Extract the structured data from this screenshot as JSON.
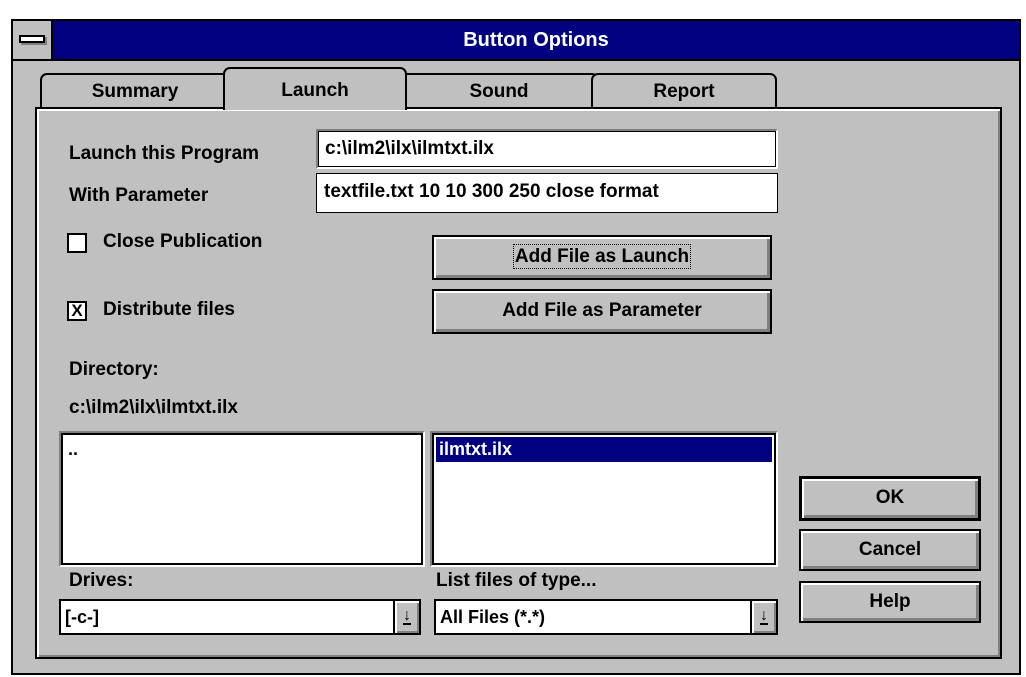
{
  "window": {
    "title": "Button Options"
  },
  "tabs": [
    {
      "label": "Summary",
      "active": false
    },
    {
      "label": "Launch",
      "active": true
    },
    {
      "label": "Sound",
      "active": false
    },
    {
      "label": "Report",
      "active": false
    }
  ],
  "launch": {
    "program_label": "Launch this Program",
    "program_value": "c:\\ilm2\\ilx\\ilmtxt.ilx",
    "parameter_label": "With Parameter",
    "parameter_value": "textfile.txt 10 10 300 250 close format",
    "close_publication_label": "Close Publication",
    "close_publication_checked": false,
    "distribute_files_label": "Distribute files",
    "distribute_files_checked": true,
    "distribute_files_mark": "X",
    "add_launch_label": "Add File as Launch",
    "add_parameter_label": "Add File as Parameter"
  },
  "browser": {
    "directory_label": "Directory:",
    "directory_value": "c:\\ilm2\\ilx\\ilmtxt.ilx",
    "directories": [
      ".."
    ],
    "files": [
      "ilmtxt.ilx"
    ],
    "selected_file": "ilmtxt.ilx",
    "drives_label": "Drives:",
    "drive_value": "[-c-]",
    "filetype_label": "List files of type...",
    "filetype_value": "All Files (*.*)"
  },
  "actions": {
    "ok_label": "OK",
    "cancel_label": "Cancel",
    "help_label": "Help"
  },
  "icons": {
    "system_menu": "system-menu-icon",
    "dropdown": "dropdown-arrow-icon"
  },
  "colors": {
    "titlebar": "#000080",
    "face": "#c0c0c0",
    "selection": "#000080"
  }
}
